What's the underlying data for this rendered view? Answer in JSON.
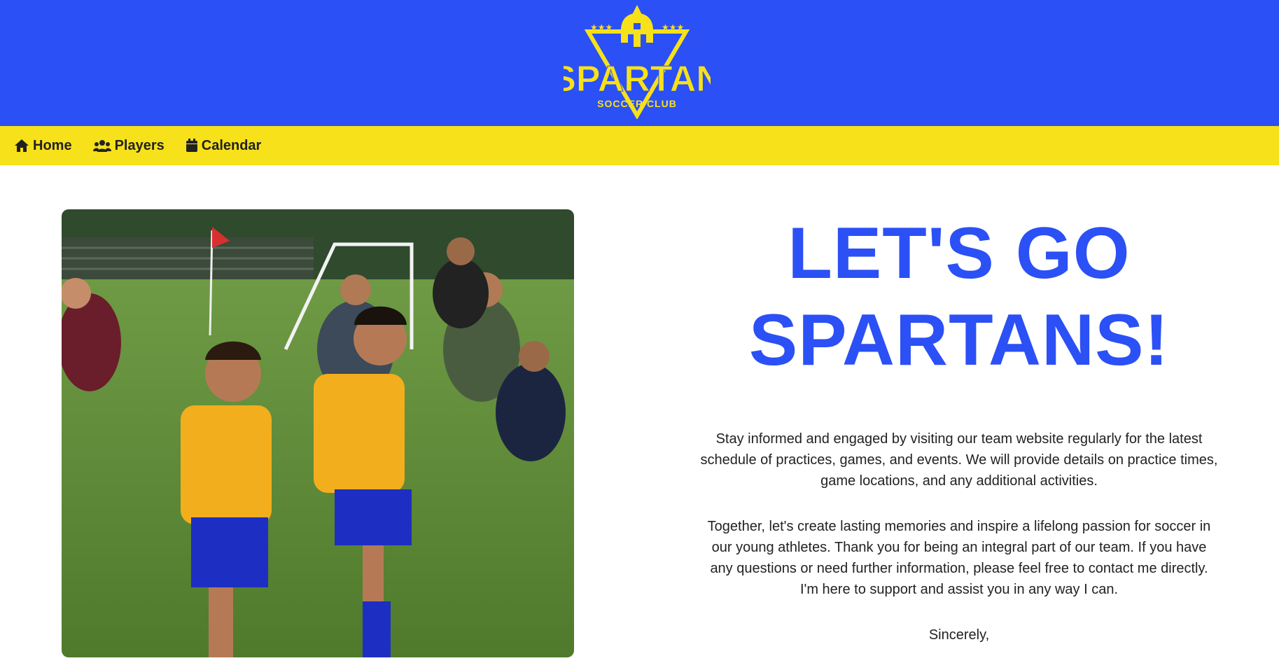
{
  "header": {
    "logo": {
      "icon": "spartan-helmet-icon",
      "text": "SPARTAN",
      "subtext": "SOCCER CLUB"
    },
    "colors": {
      "blue": "#2b50f5",
      "yellow": "#f7e11a"
    }
  },
  "nav": {
    "items": [
      {
        "label": "Home",
        "icon": "home-icon"
      },
      {
        "label": "Players",
        "icon": "users-icon"
      },
      {
        "label": "Calendar",
        "icon": "calendar-icon"
      }
    ]
  },
  "hero": {
    "headline_line1": "LET'S GO",
    "headline_line2": "SPARTANS!",
    "paragraph1": "Stay informed and engaged by visiting our team website regularly for the latest schedule of practices, games, and events. We will provide details on practice times, game locations, and any additional activities.",
    "paragraph2": "Together, let's create lasting memories and inspire a lifelong passion for soccer in our young athletes. Thank you for being an integral part of our team. If you have any questions or need further information, please feel free to contact me directly. I'm here to support and assist you in any way I can.",
    "closing": "Sincerely,"
  }
}
